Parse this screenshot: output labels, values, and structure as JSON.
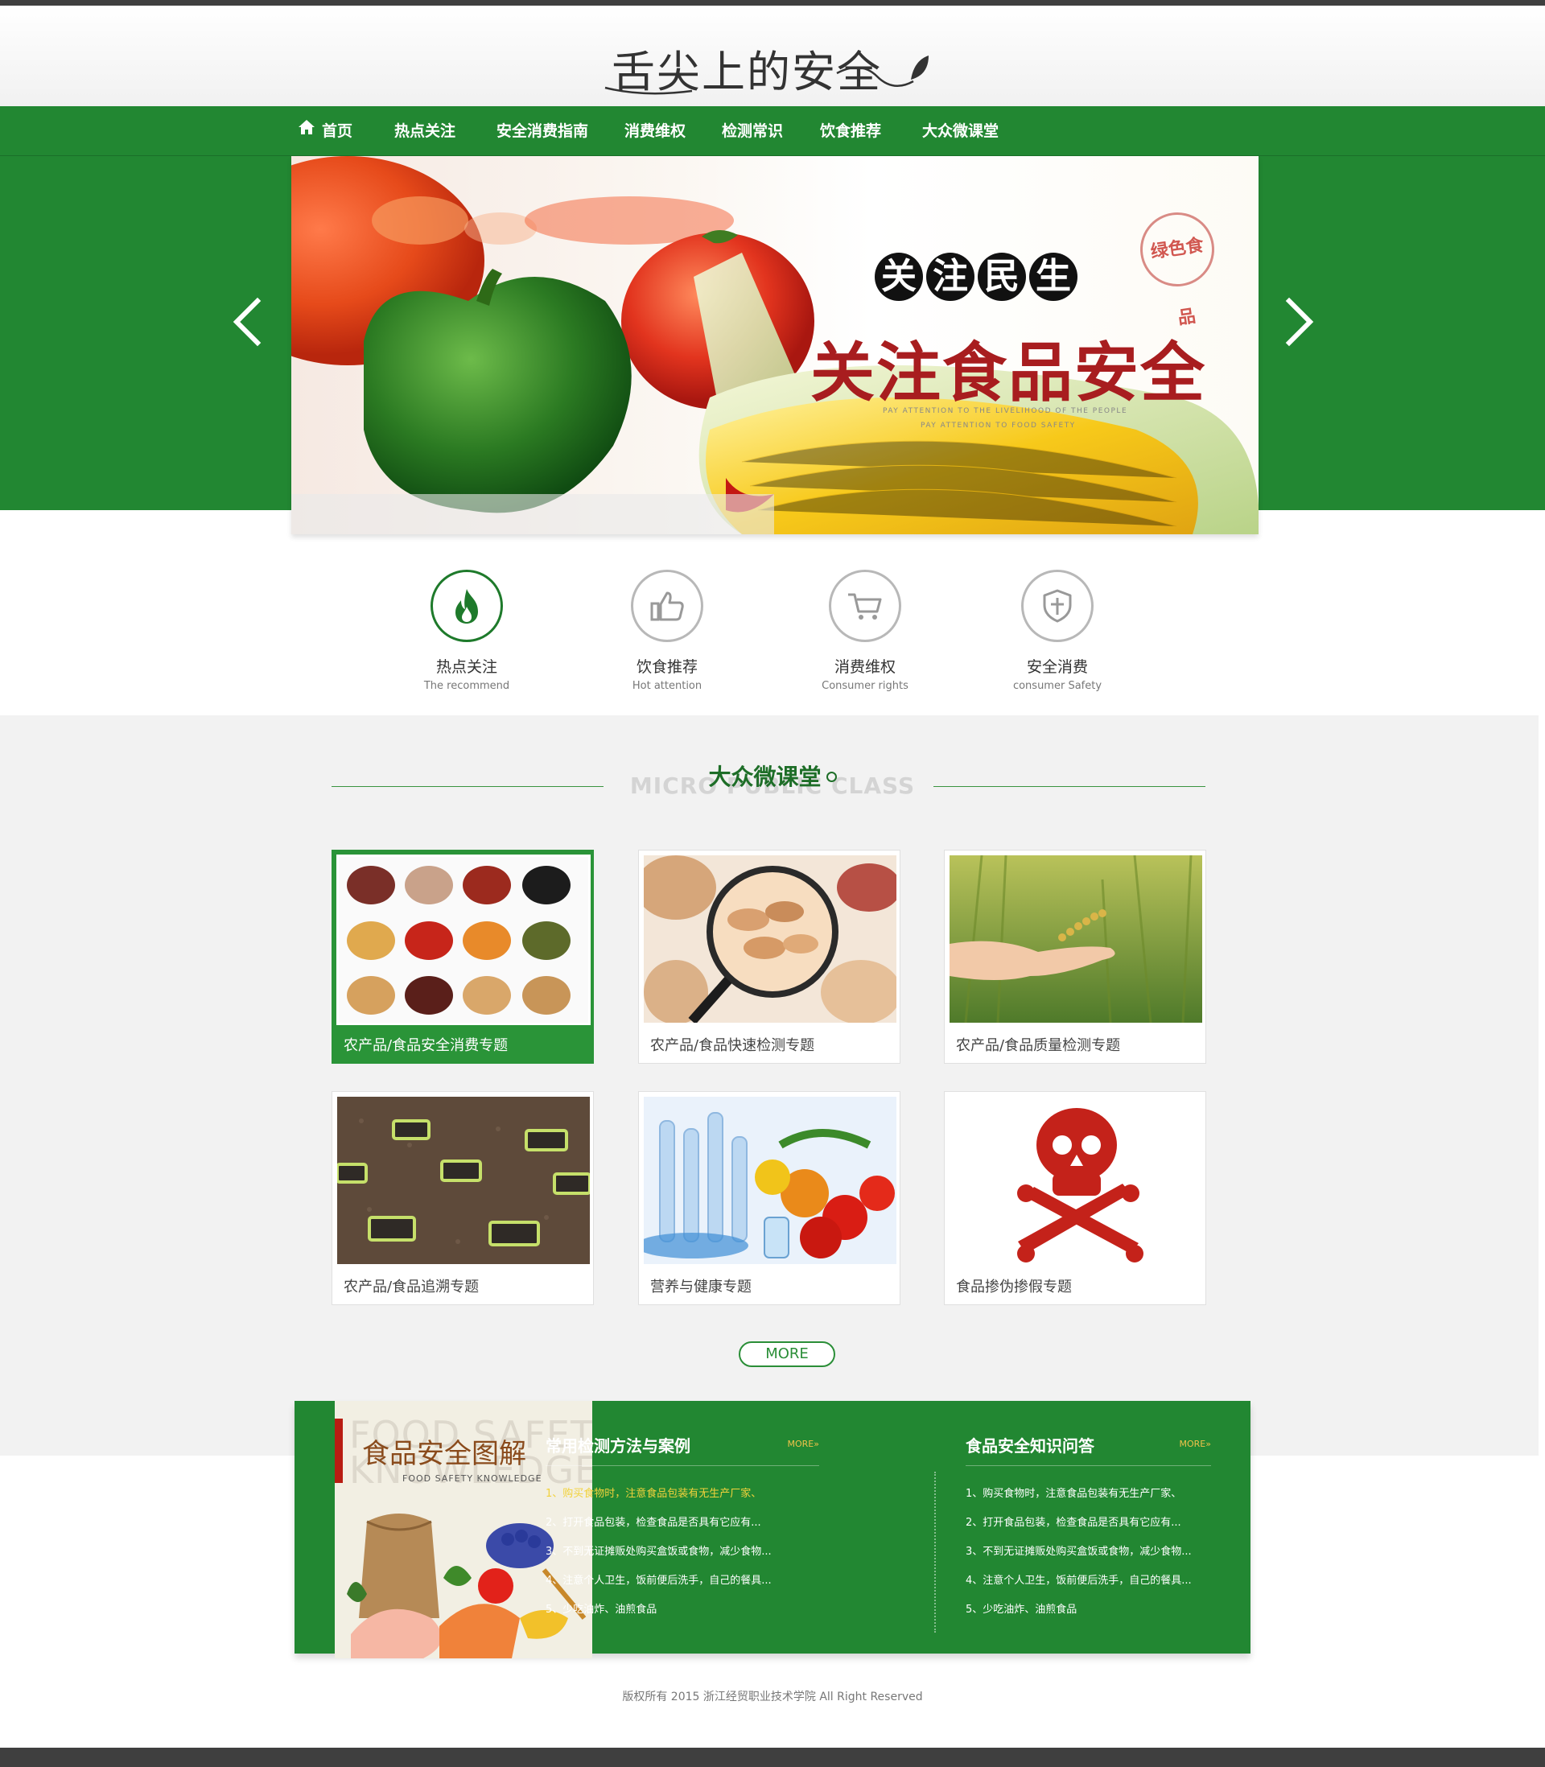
{
  "header": {
    "logo_text": "舌尖上的安全"
  },
  "nav": {
    "items": [
      "首页",
      "热点关注",
      "安全消费指南",
      "消费维权",
      "检测常识",
      "饮食推荐",
      "大众微课堂"
    ]
  },
  "banner": {
    "slogan_chars": [
      "关",
      "注",
      "民",
      "生"
    ],
    "title": "关注食品安全",
    "sub_line1": "PAY ATTENTION TO THE LIVELIHOOD OF THE PEOPLE",
    "sub_line2": "PAY ATTENTION TO FOOD SAFETY",
    "stamp": "绿色食品",
    "prev_icon": "chevron-left-icon",
    "next_icon": "chevron-right-icon"
  },
  "features": [
    {
      "title": "热点关注",
      "subtitle": "The recommend",
      "icon": "flame-icon"
    },
    {
      "title": "饮食推荐",
      "subtitle": "Hot attention",
      "icon": "thumbs-up-icon"
    },
    {
      "title": "消费维权",
      "subtitle": "Consumer rights",
      "icon": "cart-icon"
    },
    {
      "title": "安全消费",
      "subtitle": "consumer Safety",
      "icon": "shield-icon"
    }
  ],
  "section": {
    "title_cn": "大众微课堂",
    "title_en": "MICRO PUBLIC CLASS",
    "cards": [
      "农产品/食品安全消费专题",
      "农产品/食品快速检测专题",
      "农产品/食品质量检测专题",
      "农产品/食品追溯专题",
      "营养与健康专题",
      "食品掺伪掺假专题"
    ],
    "more": "MORE"
  },
  "promo": {
    "bg_text_1": "FOOD SAFETY",
    "bg_text_2": "KNOWLEDGE",
    "title": "食品安全图解",
    "subtitle": "FOOD SAFETY KNOWLEDGE"
  },
  "columns": [
    {
      "title": "常用检测方法与案例",
      "more": "MORE»",
      "items": [
        "1、购买食物时，注意食品包装有无生产厂家、",
        "2、打开食品包装，检查食品是否具有它应有...",
        "3、不到无证摊贩处购买盒饭或食物，减少食物...",
        "4、注意个人卫生，饭前便后洗手，自己的餐具...",
        "5、少吃油炸、油煎食品"
      ]
    },
    {
      "title": "食品安全知识问答",
      "more": "MORE»",
      "items": [
        "1、购买食物时，注意食品包装有无生产厂家、",
        "2、打开食品包装，检查食品是否具有它应有...",
        "3、不到无证摊贩处购买盒饭或食物，减少食物...",
        "4、注意个人卫生，饭前便后洗手，自己的餐具...",
        "5、少吃油炸、油煎食品"
      ]
    }
  ],
  "footer": {
    "copyright": "版权所有 2015 浙江经贸职业技术学院 All Right Reserved"
  },
  "colors": {
    "brand_green": "#228732",
    "dark_bar": "#3f3f3f",
    "banner_red": "#a81d1f",
    "highlight_yellow": "#f2d23c"
  }
}
